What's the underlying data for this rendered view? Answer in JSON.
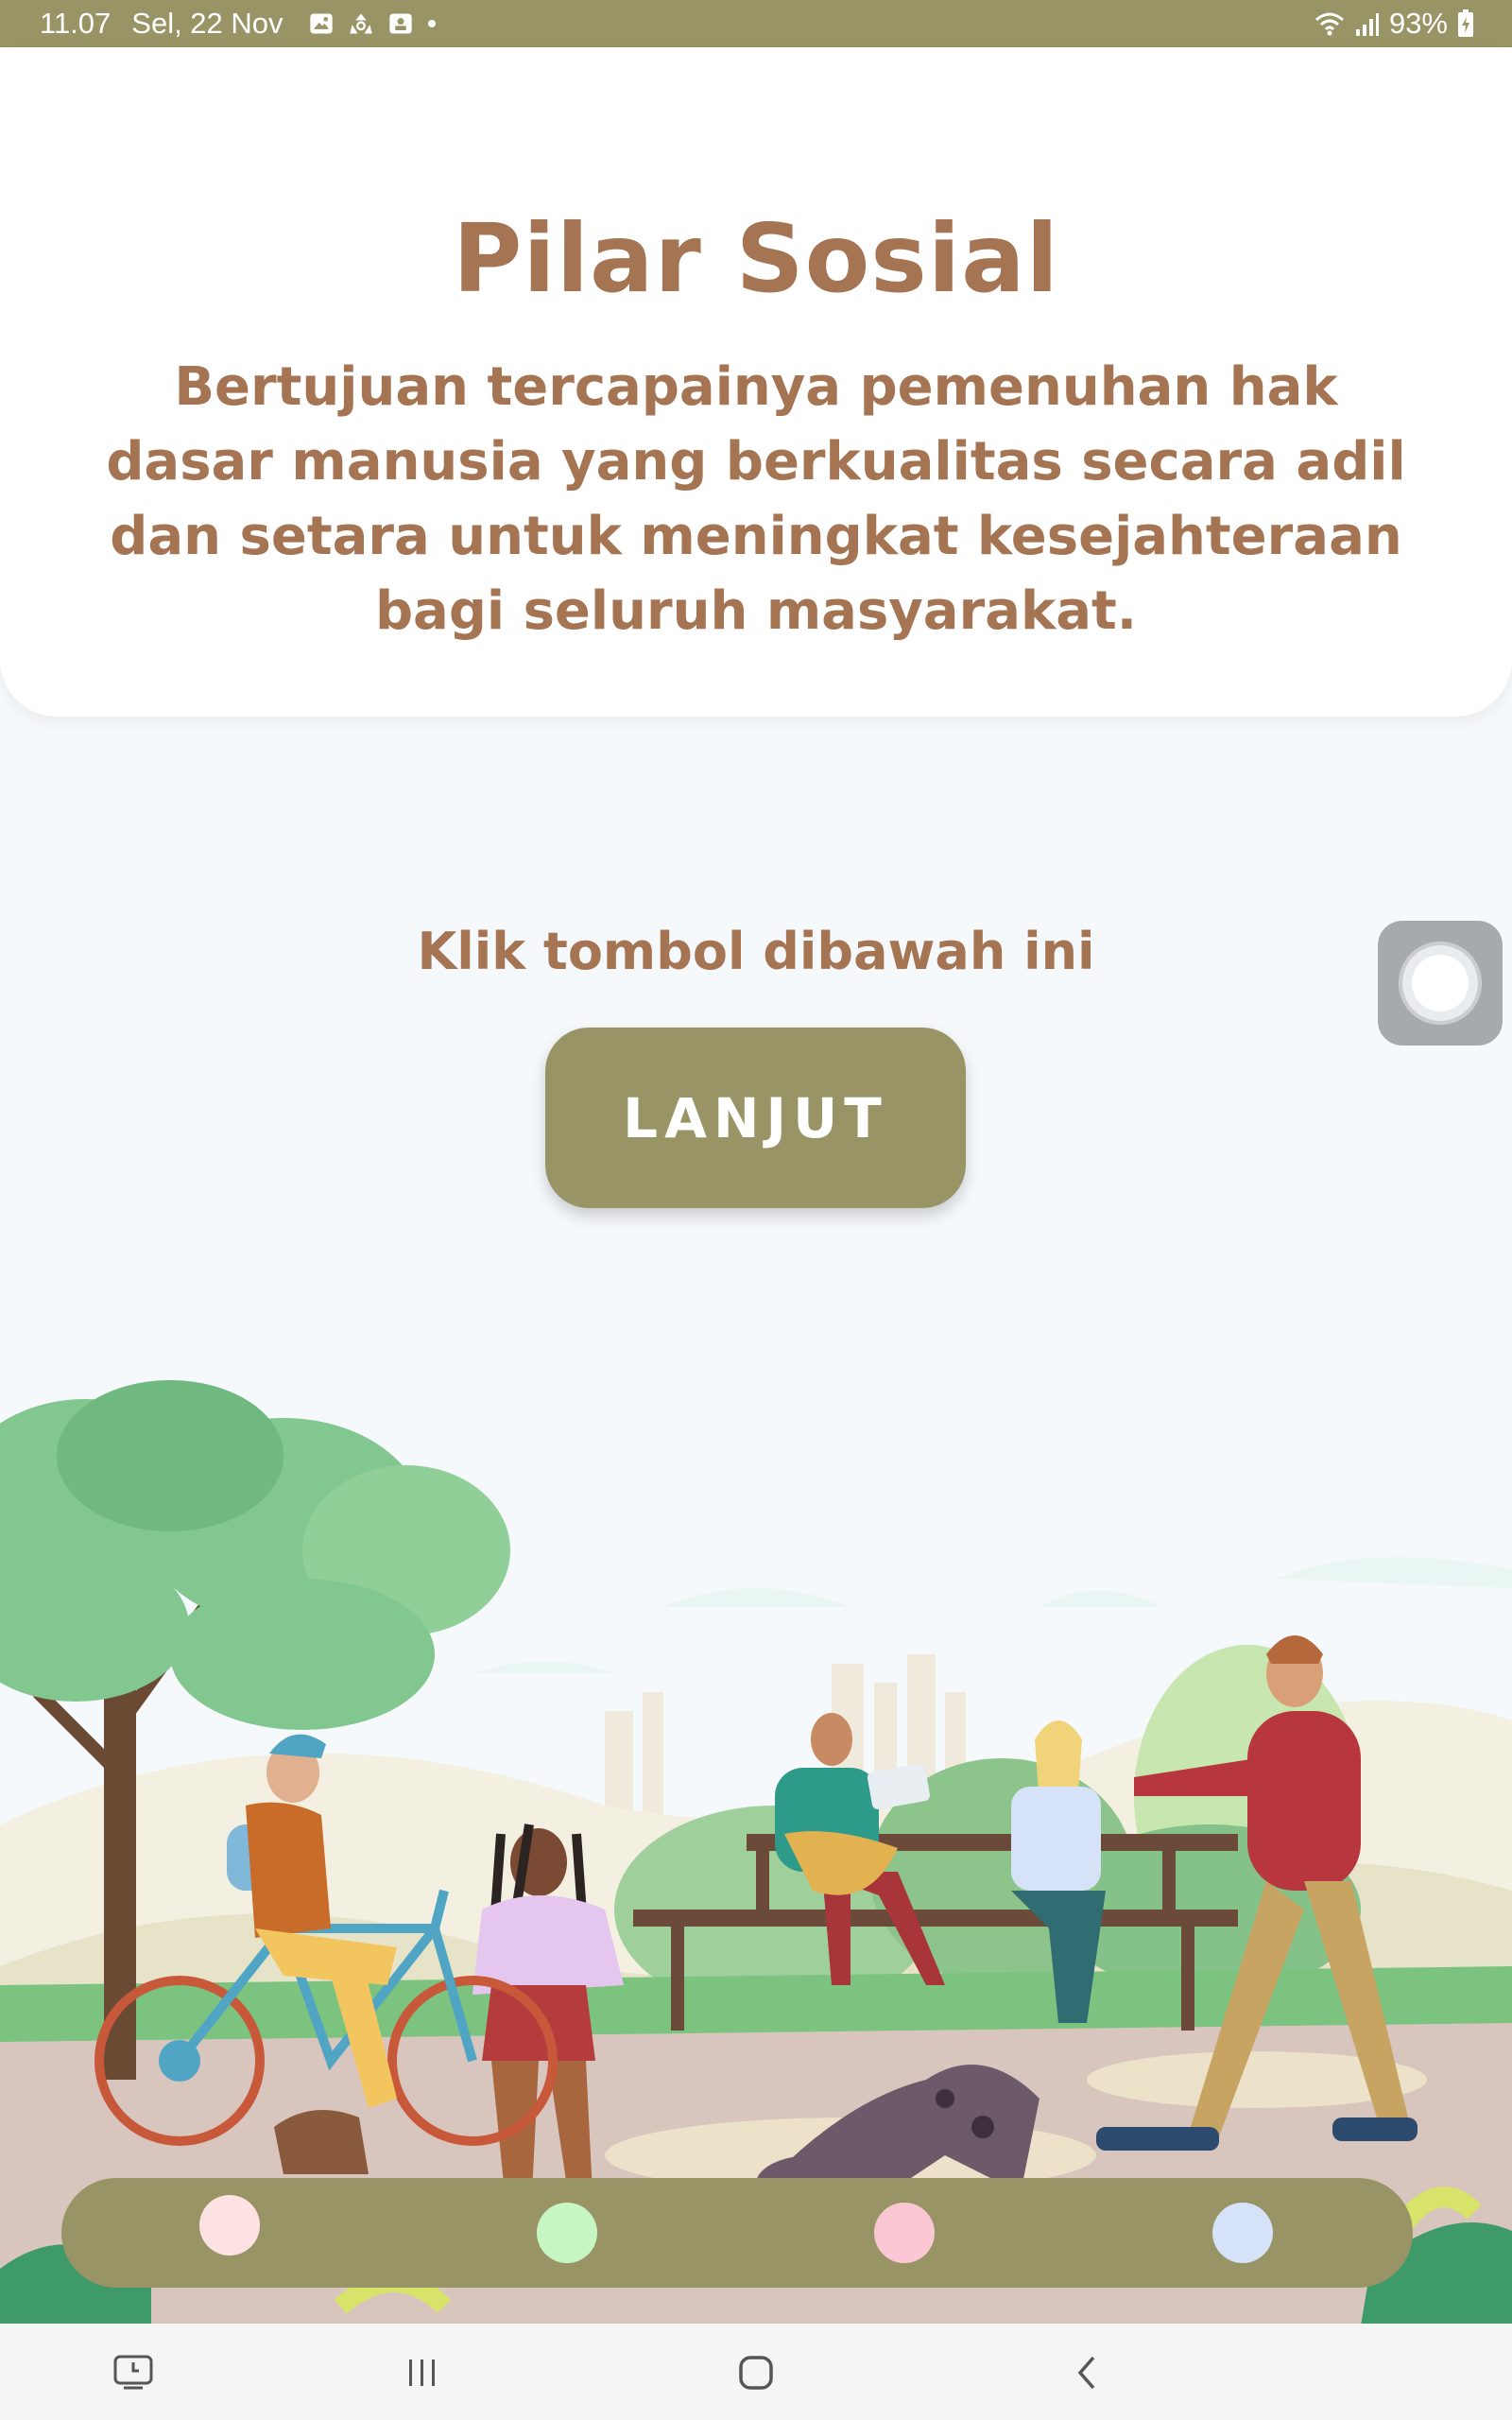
{
  "status_bar": {
    "time": "11.07",
    "date": "Sel, 22 Nov",
    "battery": "93%",
    "notification_icons": [
      "image-icon",
      "sync-icon",
      "screenshot-icon"
    ]
  },
  "header": {
    "title": "Pilar Sosial",
    "description": "Bertujuan tercapainya pemenuhan hak dasar manusia yang berkualitas secara adil dan setara untuk meningkat kesejahteraan bagi seluruh masyarakat."
  },
  "main": {
    "prompt": "Klik tombol dibawah ini",
    "button_label": "LANJUT"
  },
  "dots": [
    {
      "color": "#fde2e4"
    },
    {
      "color": "#c6f7c3"
    },
    {
      "color": "#fbc7d4"
    },
    {
      "color": "#d6e2f7"
    }
  ],
  "colors": {
    "accent": "#999466",
    "text_brown": "#a47453",
    "background": "#f5f9fb"
  },
  "nav": [
    "recent-screenshot-icon",
    "recents-icon",
    "home-icon",
    "back-icon"
  ]
}
